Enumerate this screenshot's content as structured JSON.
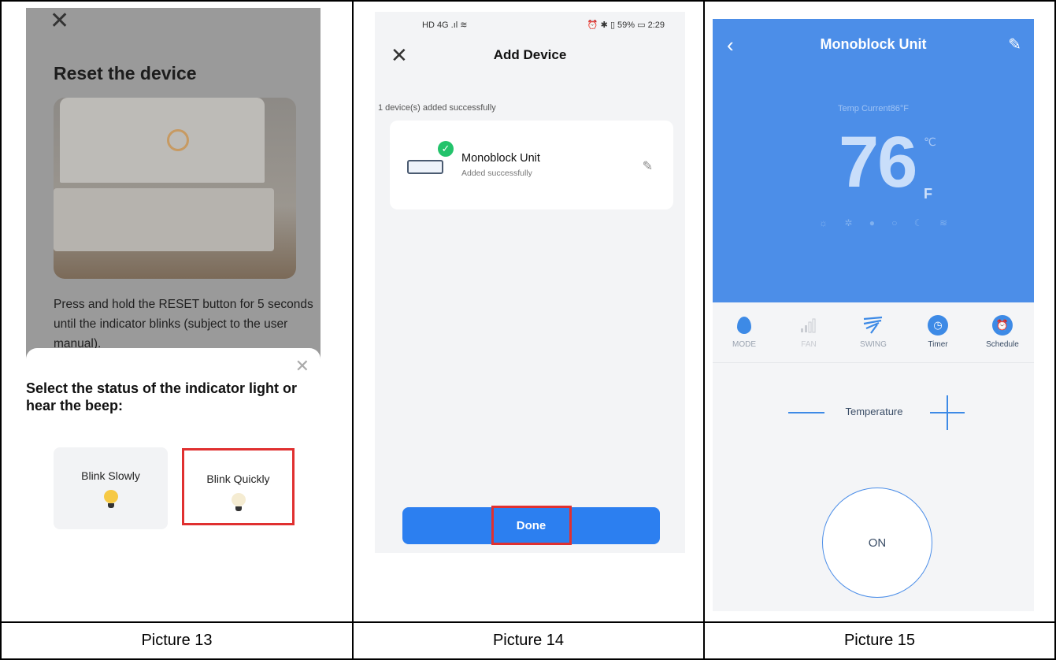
{
  "captions": [
    "Picture 13",
    "Picture 14",
    "Picture 15"
  ],
  "screen13": {
    "close_glyph": "✕",
    "title": "Reset the device",
    "description": "Press and hold the RESET button for 5 seconds until the indicator blinks (subject to the user manual).",
    "sheet_close_glyph": "✕",
    "sheet_title": "Select the status of the indicator light or hear the beep:",
    "options": [
      {
        "label": "Blink Slowly",
        "selected": false,
        "bulb_color": "#f6c945"
      },
      {
        "label": "Blink Quickly",
        "selected": true,
        "bulb_color": "#f5ecd2"
      }
    ],
    "highlight_color": "#e03030"
  },
  "screen14": {
    "status_left": "HD 4G .ıl ≋",
    "status_right": "⏰ ✱ ▯ 59% ▭ 2:29",
    "close_glyph": "✕",
    "header": "Add Device",
    "added_count": "1 device(s) added successfully",
    "device": {
      "name": "Monoblock Unit",
      "status": "Added successfully",
      "check": "✓",
      "edit_icon": "✎"
    },
    "done_label": "Done",
    "accent_color": "#2c7ff0"
  },
  "screen15": {
    "back_glyph": "‹",
    "title": "Monoblock Unit",
    "edit_glyph": "✎",
    "current_temp": "Temp Current86°F",
    "set_temp": "76",
    "unit_c": "℃",
    "unit_f": "F",
    "mode_icons": "☼ ✲ ● ○ ☾ ≋",
    "controls": [
      {
        "label": "MODE",
        "icon": "drop-icon",
        "active": true
      },
      {
        "label": "FAN",
        "icon": "fan-bars-icon",
        "active": false
      },
      {
        "label": "SWING",
        "icon": "swing-icon",
        "active": true
      },
      {
        "label": "Timer",
        "icon": "clock-icon",
        "active": true
      },
      {
        "label": "Schedule",
        "icon": "alarm-icon",
        "active": true
      }
    ],
    "temperature_label": "Temperature",
    "power_label": "ON",
    "brand_color": "#4c8ee8"
  }
}
